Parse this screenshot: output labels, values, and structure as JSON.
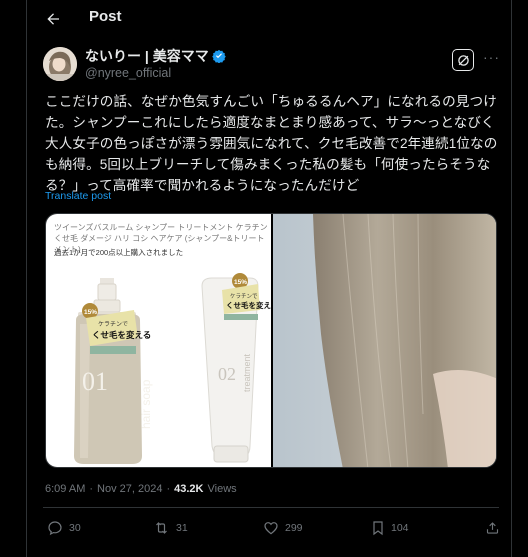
{
  "header": {
    "title": "Post",
    "back_icon": "arrow-left-icon"
  },
  "author": {
    "name": "ないりー | 美容ママ",
    "handle": "@nyree_official",
    "verified": true,
    "verified_color": "#1d9bf0"
  },
  "post": {
    "text": "ここだけの話、なぜか色気すんごい「ちゅるるんヘア」になれるの見つけた。シャンプーこれにしたら適度なまとまり感あって、サラ〜っとなびく大人女子の色っぽさが漂う雰囲気になれて、クセ毛改善で2年連続1位なのも納得。5回以上ブリーチして傷みまくった私の髪も「何使ったらそうなる？」って高確率で聞かれるようになったんだけど",
    "translate_label": "Translate post"
  },
  "media": {
    "product_caption": "ツイーンズバスルーム シャンプー トリートメント ケラチン くせ毛 ダメージ ハリ コシ ヘアケア (シャンプー&トリートメント)",
    "product_note": "過去1か月で200点以上購入されました",
    "bottle_badge": "15%",
    "bottle_tag_1": "ケラチンで",
    "bottle_tag_2": "くせ毛を変える",
    "bottle_number": "01",
    "bottle_vertical": "hair soap",
    "tube_badge": "15%",
    "tube_tag_1": "ケラチンで",
    "tube_tag_2": "くせ毛を変える",
    "tube_number": "02",
    "tube_vertical": "treatment"
  },
  "meta": {
    "time": "6:09 AM",
    "date": "Nov 27, 2024",
    "separator": "·",
    "views_count": "43.2K",
    "views_label": "Views"
  },
  "actions": {
    "replies": "30",
    "reposts": "31",
    "likes": "299",
    "bookmarks": "104"
  },
  "colors": {
    "background": "#000000",
    "text": "#e7e9ea",
    "secondary": "#71767b",
    "accent": "#1d9bf0",
    "border": "#2f3336"
  }
}
